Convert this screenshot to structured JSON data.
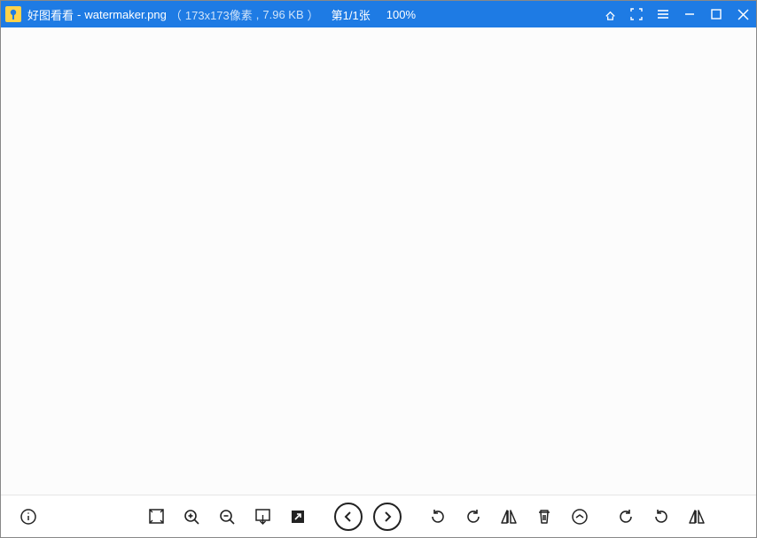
{
  "title": {
    "app_name": "好图看看",
    "separator": "-",
    "filename": "watermaker.png",
    "open_paren": "（",
    "dimensions": "173x173像素",
    "comma": ",",
    "filesize": "7.96 KB",
    "close_paren": "）",
    "page_label": "第1/1张",
    "zoom": "100%"
  }
}
